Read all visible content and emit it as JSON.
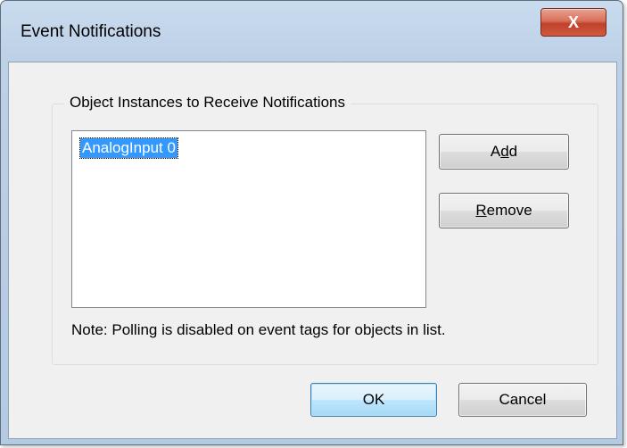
{
  "window": {
    "title": "Event Notifications",
    "close_glyph": "X"
  },
  "group": {
    "label": "Object Instances to Receive Notifications"
  },
  "list": {
    "items": [
      "AnalogInput 0"
    ],
    "selected_index": 0
  },
  "buttons": {
    "add": {
      "prefix": "A",
      "mnemonic": "d",
      "suffix": "d"
    },
    "remove": {
      "prefix": "",
      "mnemonic": "R",
      "suffix": "emove"
    },
    "ok": "OK",
    "cancel": "Cancel"
  },
  "note": "Note: Polling is disabled on event tags for objects in list.",
  "colors": {
    "selection": "#3399ff",
    "close_button": "#c0412a",
    "titlebar": "#bcd0e6"
  }
}
